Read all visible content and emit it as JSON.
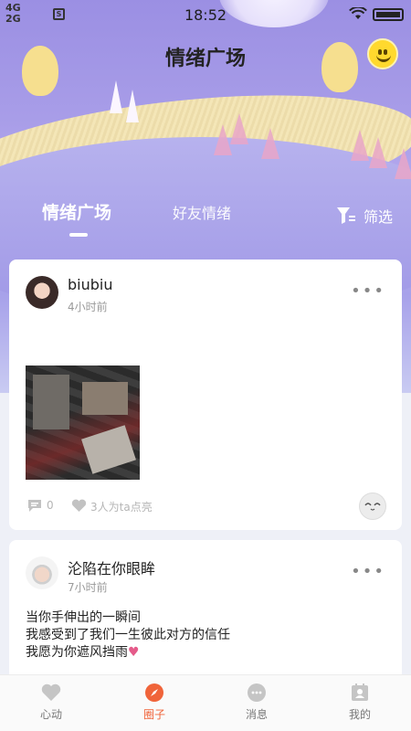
{
  "status_bar": {
    "network_top": "4G",
    "network_bottom": "2G",
    "time": "18:52"
  },
  "header": {
    "title": "情绪广场",
    "avatar_icon": "smiley-face-icon"
  },
  "tabs": [
    {
      "label": "情绪广场",
      "active": true
    },
    {
      "label": "好友情绪",
      "active": false
    }
  ],
  "filter": {
    "label": "筛选"
  },
  "posts": [
    {
      "username": "biubiu",
      "time_ago": "4小时前",
      "text": "",
      "comment_count": "0",
      "like_text": "3人为ta点亮"
    },
    {
      "username": "沦陷在你眼眸",
      "time_ago": "7小时前",
      "lines": [
        "当你手伸出的一瞬间",
        "我感受到了我们一生彼此对方的信任",
        "我愿为你遮风挡雨"
      ],
      "emoji": "♥"
    }
  ],
  "bottom_nav": [
    {
      "label": "心动",
      "icon": "heart-icon",
      "active": false
    },
    {
      "label": "圈子",
      "icon": "compass-icon",
      "active": true
    },
    {
      "label": "消息",
      "icon": "chat-bubble-icon",
      "active": false
    },
    {
      "label": "我的",
      "icon": "profile-card-icon",
      "active": false
    }
  ],
  "colors": {
    "accent": "#f0643a",
    "hero_top": "#9b8fe3",
    "muted_text": "#9a9a9a"
  }
}
